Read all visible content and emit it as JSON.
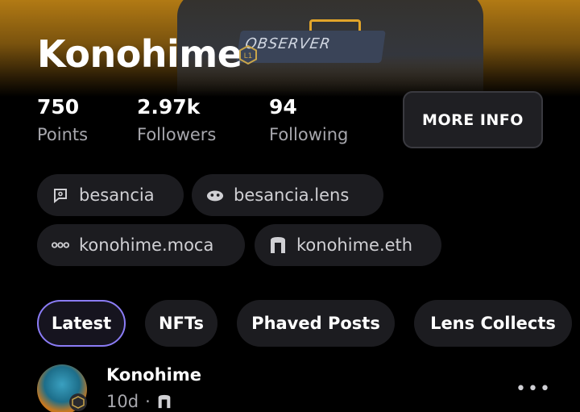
{
  "profile": {
    "name": "Konohime",
    "level_badge": "L1",
    "hero_text": "OBSERVER"
  },
  "stats": [
    {
      "value": "750",
      "label": "Points"
    },
    {
      "value": "2.97k",
      "label": "Followers"
    },
    {
      "value": "94",
      "label": "Following"
    }
  ],
  "more_info_label": "MORE INFO",
  "handles": [
    {
      "icon": "chat-bubble-icon",
      "label": "besancia"
    },
    {
      "icon": "lens-icon",
      "label": "besancia.lens"
    },
    {
      "icon": "moca-dots-icon",
      "label": "konohime.moca"
    },
    {
      "icon": "ens-arch-icon",
      "label": "konohime.eth"
    }
  ],
  "tabs": [
    {
      "label": "Latest",
      "active": true
    },
    {
      "label": "NFTs",
      "active": false
    },
    {
      "label": "Phaved Posts",
      "active": false
    },
    {
      "label": "Lens Collects",
      "active": false
    }
  ],
  "post": {
    "author": "Konohime",
    "time": "10d",
    "separator": "·",
    "menu": "•••"
  },
  "colors": {
    "accent_active_tab": "#8b7cf6",
    "hero_gold": "#b27a14",
    "chip_bg": "#1c1c20"
  }
}
